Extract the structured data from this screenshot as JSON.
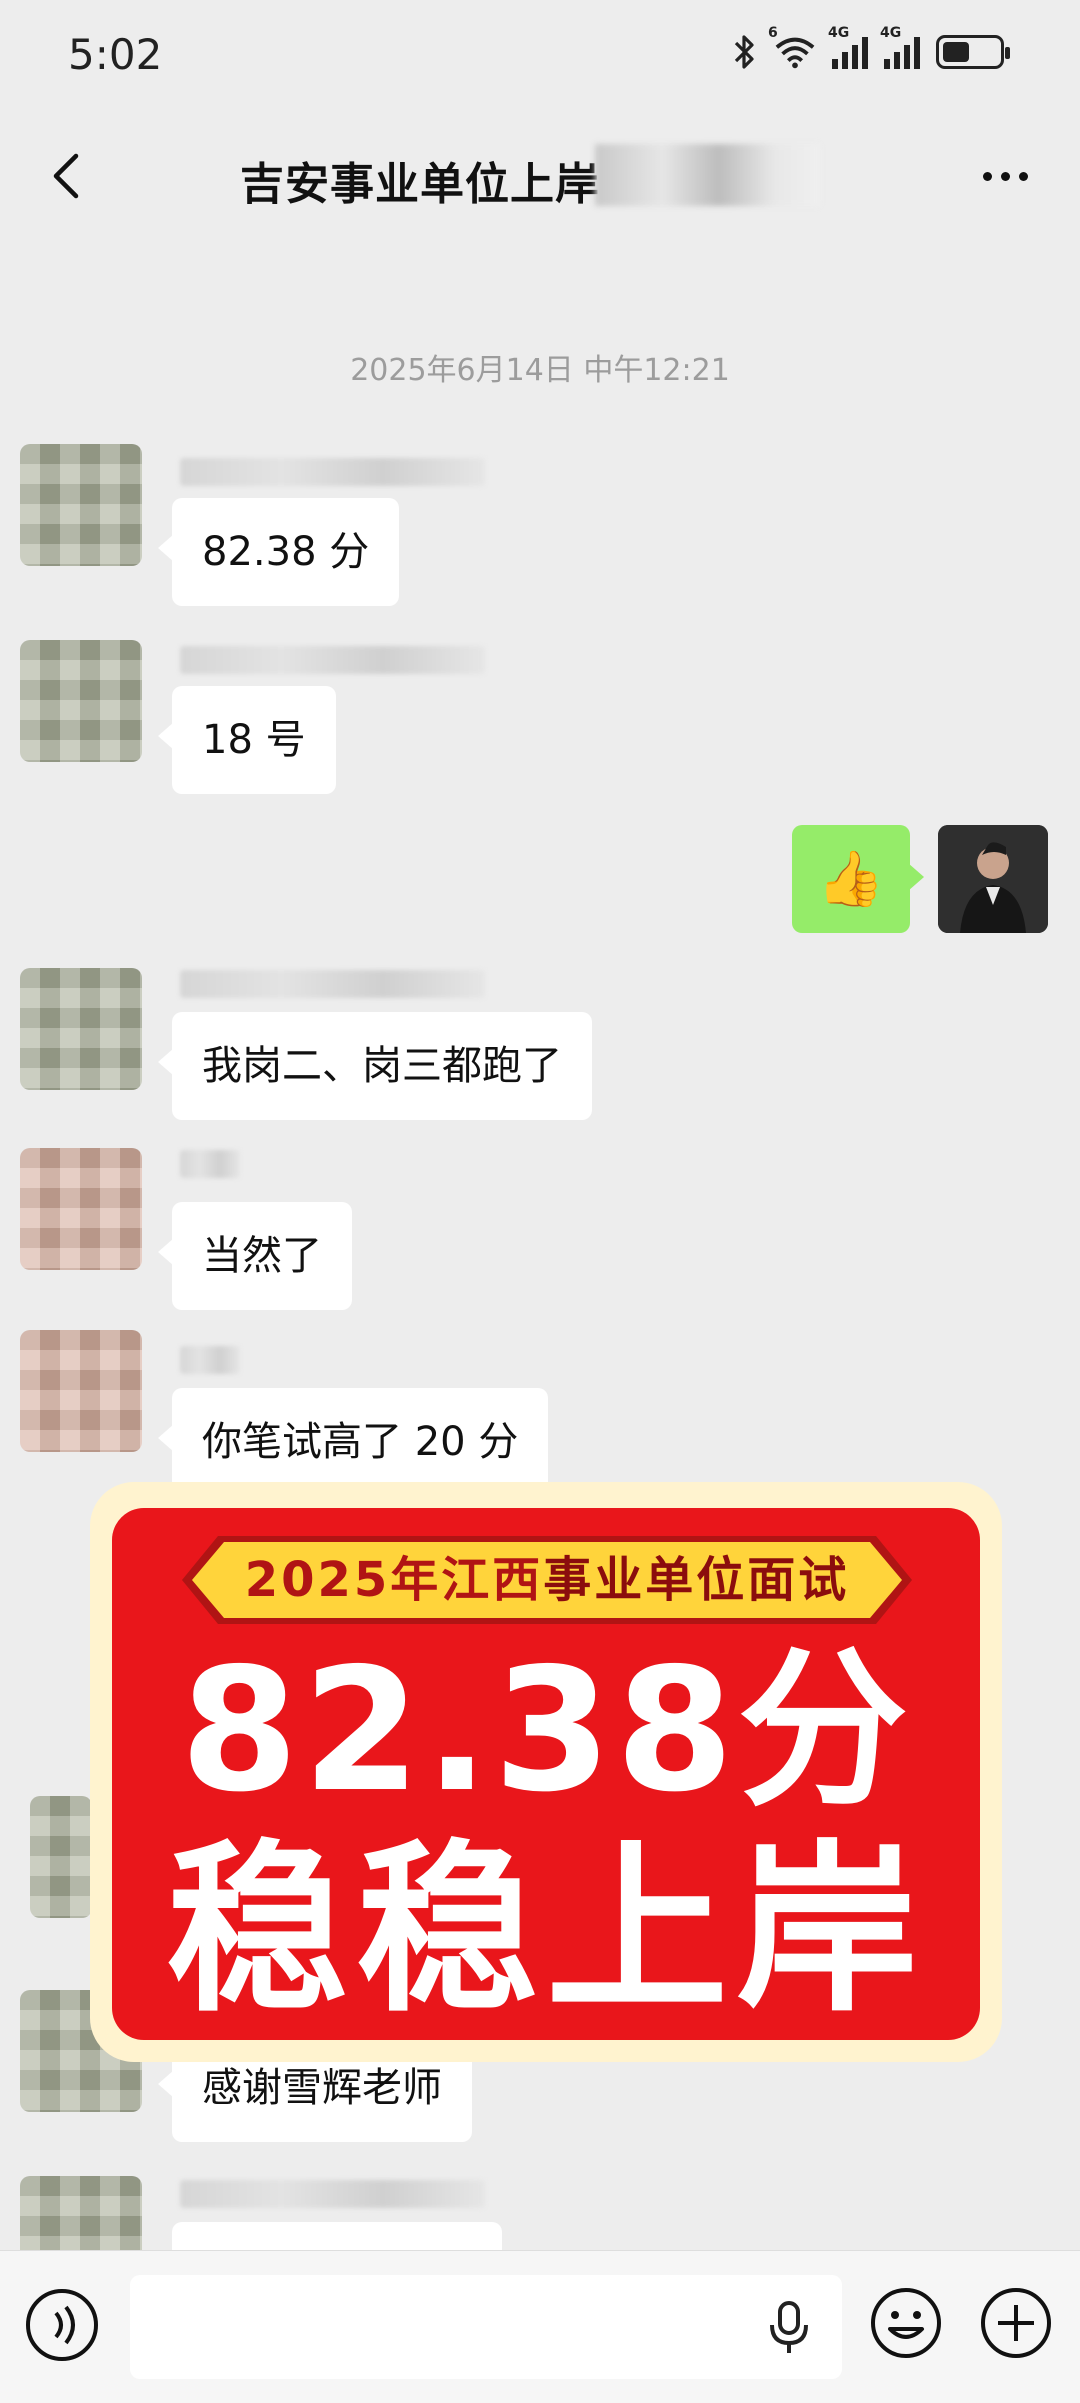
{
  "status_bar": {
    "time": "5:02",
    "network_1": "4G",
    "network_2": "4G",
    "wifi_badge": "6"
  },
  "header": {
    "title": "吉安事业单位上岸",
    "back_icon": "chevron-left-icon",
    "more_icon": "more-icon"
  },
  "chat": {
    "timestamp": "2025年6月14日 中午12:21",
    "messages": [
      {
        "side": "left",
        "text": "82.38 分"
      },
      {
        "side": "left",
        "text": "18 号"
      },
      {
        "side": "right",
        "icon": "thumbs-up-icon"
      },
      {
        "side": "left",
        "text": "我岗二、岗三都跑了"
      },
      {
        "side": "left",
        "text": "当然了"
      },
      {
        "side": "left",
        "text": "你笔试高了 20 分"
      },
      {
        "side": "left",
        "text": "感谢雪辉老师"
      }
    ]
  },
  "banner": {
    "ribbon_part1": "2025年江西",
    "ribbon_part2": "事业单位面试",
    "score": "82.38分",
    "slogan": "稳稳上岸"
  },
  "input_bar": {
    "voice_icon": "voice-icon",
    "mic_icon": "mic-icon",
    "emoji_icon": "emoji-icon",
    "plus_icon": "plus-icon"
  },
  "colors": {
    "background": "#ededed",
    "sent_bubble": "#95ec69",
    "banner_red": "#e9161b",
    "ribbon_yellow": "#ffd43b"
  }
}
